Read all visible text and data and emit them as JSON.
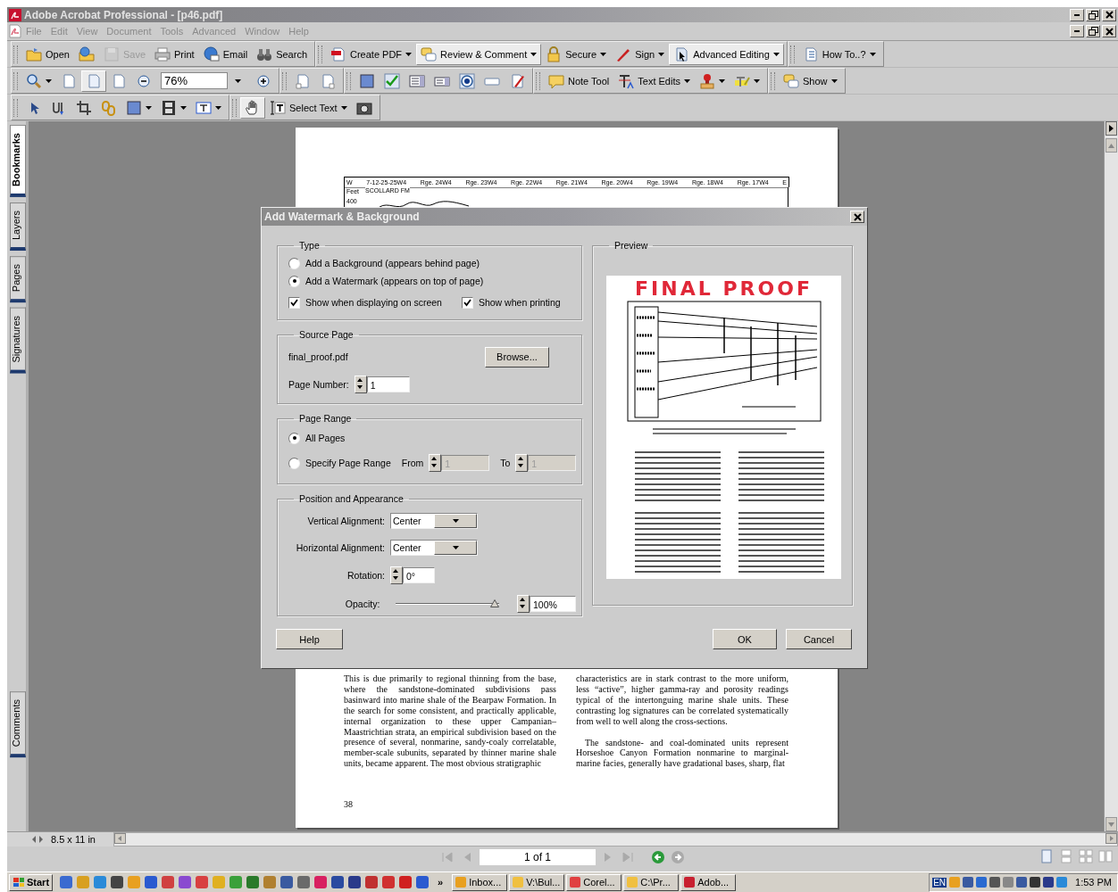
{
  "window": {
    "title": "Adobe Acrobat Professional - [p46.pdf]"
  },
  "menu": [
    "File",
    "Edit",
    "View",
    "Document",
    "Tools",
    "Advanced",
    "Window",
    "Help"
  ],
  "toolbars": [
    {
      "groups": [
        {
          "items": [
            {
              "kind": "button",
              "label": "Open",
              "dropdown": false,
              "disabled": false,
              "pressed": false
            },
            {
              "kind": "button",
              "dropdown": false,
              "disabled": false,
              "pressed": false
            },
            {
              "kind": "button",
              "label": "Save",
              "dropdown": false,
              "disabled": true,
              "pressed": false
            },
            {
              "kind": "button",
              "label": "Print",
              "dropdown": false,
              "disabled": false,
              "pressed": false
            },
            {
              "kind": "button",
              "label": "Email",
              "dropdown": false,
              "disabled": false,
              "pressed": false
            },
            {
              "kind": "button",
              "label": "Search",
              "dropdown": false,
              "disabled": false,
              "pressed": false
            }
          ]
        },
        {
          "items": [
            {
              "kind": "button",
              "label": "Create PDF",
              "dropdown": true,
              "disabled": false,
              "pressed": false
            },
            {
              "kind": "button",
              "label": "Review & Comment",
              "dropdown": true,
              "disabled": false,
              "pressed": true
            },
            {
              "kind": "button",
              "label": "Secure",
              "dropdown": true,
              "disabled": false,
              "pressed": false
            },
            {
              "kind": "button",
              "label": "Sign",
              "dropdown": true,
              "disabled": false,
              "pressed": false
            },
            {
              "kind": "button",
              "label": "Advanced Editing",
              "dropdown": true,
              "disabled": false,
              "pressed": true
            }
          ]
        },
        {
          "items": [
            {
              "kind": "button",
              "label": "How To..?",
              "dropdown": true,
              "disabled": false,
              "pressed": false
            }
          ]
        }
      ]
    },
    {
      "groups": [
        {
          "items": [
            {
              "kind": "button",
              "dropdown": true,
              "disabled": false,
              "pressed": false
            },
            {
              "kind": "button",
              "dropdown": false,
              "disabled": false,
              "pressed": false
            },
            {
              "kind": "button",
              "dropdown": false,
              "disabled": false,
              "pressed": true
            },
            {
              "kind": "button",
              "dropdown": false,
              "disabled": false,
              "pressed": false
            },
            {
              "kind": "button",
              "dropdown": false,
              "disabled": false,
              "pressed": false
            },
            {
              "kind": "field",
              "value": "76%",
              "dropdown": true,
              "disabled": false,
              "pressed": false
            },
            {
              "kind": "button",
              "dropdown": false,
              "disabled": false,
              "pressed": false
            }
          ]
        },
        {
          "items": [
            {
              "kind": "button",
              "dropdown": false,
              "disabled": false,
              "pressed": false
            },
            {
              "kind": "button",
              "dropdown": false,
              "disabled": false,
              "pressed": false
            }
          ]
        },
        {
          "items": [
            {
              "kind": "button",
              "dropdown": false,
              "disabled": false,
              "pressed": false
            },
            {
              "kind": "button",
              "dropdown": false,
              "disabled": false,
              "pressed": false
            },
            {
              "kind": "button",
              "dropdown": false,
              "disabled": false,
              "pressed": false
            },
            {
              "kind": "button",
              "dropdown": false,
              "disabled": false,
              "pressed": false
            },
            {
              "kind": "button",
              "dropdown": false,
              "disabled": false,
              "pressed": false
            },
            {
              "kind": "button",
              "dropdown": false,
              "disabled": false,
              "pressed": false
            },
            {
              "kind": "button",
              "dropdown": false,
              "disabled": false,
              "pressed": false
            }
          ]
        },
        {
          "items": [
            {
              "kind": "button",
              "label": "Note Tool",
              "dropdown": false,
              "disabled": false,
              "pressed": false
            },
            {
              "kind": "button",
              "label": "Text Edits",
              "dropdown": true,
              "disabled": false,
              "pressed": false
            },
            {
              "kind": "button",
              "dropdown": true,
              "disabled": false,
              "pressed": false
            },
            {
              "kind": "button",
              "dropdown": true,
              "disabled": false,
              "pressed": false
            }
          ]
        },
        {
          "items": [
            {
              "kind": "button",
              "label": "Show",
              "dropdown": true,
              "disabled": false,
              "pressed": false
            }
          ]
        }
      ]
    },
    {
      "groups": [
        {
          "items": [
            {
              "kind": "button",
              "dropdown": false,
              "disabled": false,
              "pressed": false
            },
            {
              "kind": "button",
              "dropdown": false,
              "disabled": false,
              "pressed": false
            },
            {
              "kind": "button",
              "dropdown": false,
              "disabled": false,
              "pressed": false
            },
            {
              "kind": "button",
              "dropdown": false,
              "disabled": false,
              "pressed": false
            },
            {
              "kind": "button",
              "dropdown": true,
              "disabled": false,
              "pressed": false
            },
            {
              "kind": "button",
              "dropdown": true,
              "disabled": false,
              "pressed": false
            },
            {
              "kind": "button",
              "dropdown": true,
              "disabled": false,
              "pressed": false
            }
          ]
        },
        {
          "items": [
            {
              "kind": "button",
              "dropdown": false,
              "disabled": false,
              "pressed": true
            },
            {
              "kind": "button",
              "label": "Select Text",
              "dropdown": true,
              "disabled": false,
              "pressed": false
            },
            {
              "kind": "button",
              "dropdown": false,
              "disabled": false,
              "pressed": false
            }
          ]
        }
      ]
    }
  ],
  "side_tabs": [
    {
      "label": "Bookmarks",
      "selected": true
    },
    {
      "label": "Layers",
      "selected": false
    },
    {
      "label": "Pages",
      "selected": false
    },
    {
      "label": "Signatures",
      "selected": false
    }
  ],
  "comments_tab": {
    "label": "Comments",
    "selected": false
  },
  "page": {
    "figure_header": [
      "W",
      "7-12-25-25W4",
      "Rge. 24W4",
      "Rge. 23W4",
      "Rge. 22W4",
      "Rge. 21W4",
      "Rge. 20W4",
      "Rge. 19W4",
      "Rge. 18W4",
      "Rge. 17W4",
      "E"
    ],
    "figure_notes": [
      "Feet",
      "SCOLLARD FM",
      "400"
    ],
    "columns": [
      [
        "This is due primarily to regional thinning from the base, where the sandstone-dominated subdivisions pass basinward into marine shale of the Bearpaw Formation. In the search for some consistent, and practically applicable, internal organization to these upper Campanian–Maastrichtian strata, an empirical subdivision based on the presence of several, nonmarine, sandy-coaly correlatable, member-scale subunits, separated by thinner marine shale units, became apparent. The most obvious stratigraphic"
      ],
      [
        "characteristics are in stark contrast to the more uniform, less “active”, higher gamma-ray and porosity readings typical of the intertonguing marine shale units. These contrasting log signatures can be correlated systematically from well to well along the cross-sections.",
        "The sandstone- and coal-dominated units represent Horseshoe Canyon Formation nonmarine to marginal-marine facies, generally have gradational bases, sharp, flat"
      ]
    ],
    "page_number": "38"
  },
  "dialog": {
    "title": "Add Watermark & Background",
    "type": {
      "legend": "Type",
      "options": [
        {
          "label": "Add a Background (appears behind page)",
          "selected": false
        },
        {
          "label": "Add a Watermark (appears on top of page)",
          "selected": true
        }
      ],
      "checks": [
        {
          "label": "Show when displaying on screen",
          "checked": true
        },
        {
          "label": "Show when printing",
          "checked": true
        }
      ]
    },
    "source": {
      "legend": "Source Page",
      "file": "final_proof.pdf",
      "browse": "Browse...",
      "page_label": "Page Number:",
      "page_value": "1"
    },
    "range": {
      "legend": "Page Range",
      "options": [
        {
          "label": "All Pages",
          "selected": true
        },
        {
          "label": "Specify Page Range",
          "selected": false
        }
      ],
      "from_label": "From",
      "from_value": "1",
      "to_label": "To",
      "to_value": "1",
      "fields_disabled": true
    },
    "position": {
      "legend": "Position and Appearance",
      "vertical_label": "Vertical Alignment:",
      "vertical_value": "Center",
      "horizontal_label": "Horizontal Alignment:",
      "horizontal_value": "Center",
      "rotation_label": "Rotation:",
      "rotation_value": "0°",
      "opacity_label": "Opacity:",
      "opacity": {
        "level": 1
      },
      "opacity_value": "100%"
    },
    "preview": {
      "legend": "Preview",
      "watermark_text": "FINAL PROOF"
    },
    "help": "Help",
    "ok": "OK",
    "cancel": "Cancel"
  },
  "status": {
    "page_size": "8.5 x 11 in",
    "page_indicator": "1 of 1"
  },
  "taskbar": {
    "start": "Start",
    "more": "»",
    "tasks": [
      "Inbox...",
      "V:\\Bul...",
      "Corel...",
      "C:\\Pr...",
      "Adob..."
    ],
    "language": "EN",
    "clock": "1:53 PM"
  }
}
